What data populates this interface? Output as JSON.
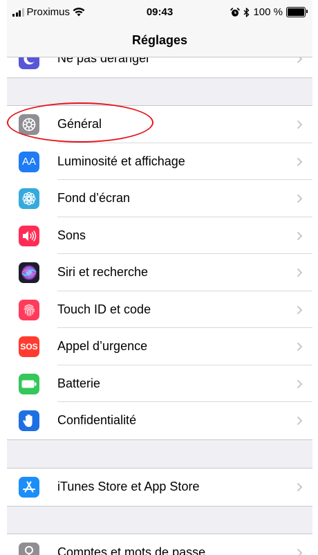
{
  "status_bar": {
    "carrier": "Proximus",
    "time": "09:43",
    "battery": "100 %",
    "icons": [
      "signal-icon",
      "wifi-icon",
      "alarm-icon",
      "bluetooth-icon",
      "battery-icon"
    ]
  },
  "nav": {
    "title": "Réglages"
  },
  "groups": [
    {
      "rows": [
        {
          "label": "Ne pas déranger",
          "icon": "moon-icon",
          "color": "#5856d6"
        }
      ]
    },
    {
      "rows": [
        {
          "label": "Général",
          "icon": "gear-icon",
          "color": "#8e8e93"
        },
        {
          "label": "Luminosité et affichage",
          "icon": "display-icon",
          "color": "#1f7cf4",
          "glyph": "AA"
        },
        {
          "label": "Fond d’écran",
          "icon": "wallpaper-icon",
          "color": "#36aadc"
        },
        {
          "label": "Sons",
          "icon": "speaker-icon",
          "color": "#ff2d55"
        },
        {
          "label": "Siri et recherche",
          "icon": "siri-icon",
          "color": "#1c1c2e"
        },
        {
          "label": "Touch ID et code",
          "icon": "fingerprint-icon",
          "color": "#ff3b5c"
        },
        {
          "label": "Appel d’urgence",
          "icon": "sos-icon",
          "color": "#ff3b30",
          "glyph": "SOS"
        },
        {
          "label": "Batterie",
          "icon": "battery-icon",
          "color": "#34c759"
        },
        {
          "label": "Confidentialité",
          "icon": "hand-icon",
          "color": "#1f6fe4"
        }
      ]
    },
    {
      "rows": [
        {
          "label": "iTunes Store et App Store",
          "icon": "app-store-icon",
          "color": "#1c8ef9"
        }
      ]
    },
    {
      "rows": [
        {
          "label": "Comptes et mots de passe",
          "icon": "key-icon",
          "color": "#8e8e93"
        }
      ]
    }
  ],
  "colors": {
    "background": "#efeff4",
    "annotation": "#e5151c",
    "chevron": "#c7c7cc"
  }
}
